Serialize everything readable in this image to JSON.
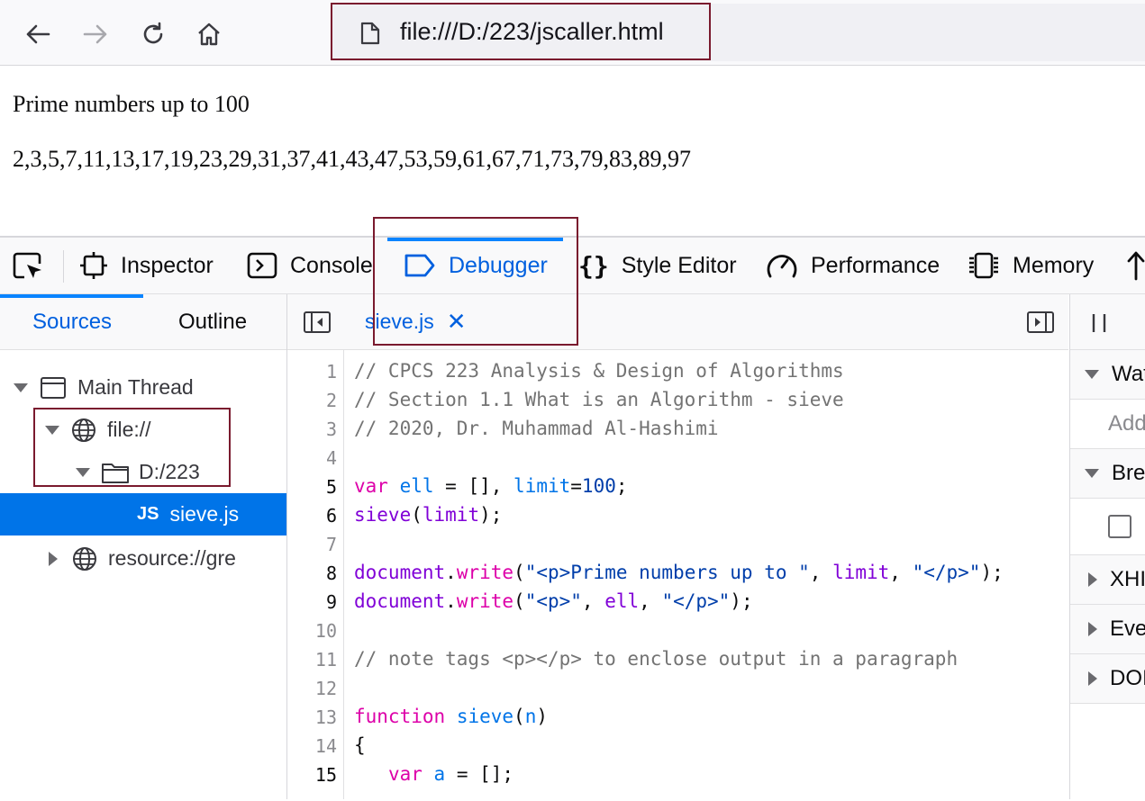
{
  "browser": {
    "url": "file:///D:/223/jscaller.html"
  },
  "page": {
    "heading": "Prime numbers up to 100",
    "primes": "2,3,5,7,11,13,17,19,23,29,31,37,41,43,47,53,59,61,67,71,73,79,83,89,97"
  },
  "devtools": {
    "tabs": [
      {
        "label": "Inspector"
      },
      {
        "label": "Console"
      },
      {
        "label": "Debugger"
      },
      {
        "label": "Style Editor"
      },
      {
        "label": "Performance"
      },
      {
        "label": "Memory"
      }
    ],
    "left_tabs": [
      {
        "label": "Sources"
      },
      {
        "label": "Outline"
      }
    ],
    "tree": [
      {
        "label": "Main Thread"
      },
      {
        "label": "file://"
      },
      {
        "label": "D:/223"
      },
      {
        "label": "sieve.js",
        "badge": "JS"
      },
      {
        "label": "resource://gre"
      }
    ],
    "editor_tab": "sieve.js",
    "right_panels": [
      {
        "label": "Wat"
      },
      {
        "label": "Add"
      },
      {
        "label": "Brea"
      },
      {
        "label": "XHI"
      },
      {
        "label": "Eve"
      },
      {
        "label": "DOI"
      }
    ],
    "line_numbers": [
      "1",
      "2",
      "3",
      "4",
      "5",
      "6",
      "7",
      "8",
      "9",
      "10",
      "11",
      "12",
      "13",
      "14",
      "15"
    ],
    "code": [
      "// CPCS 223 Analysis & Design of Algorithms",
      "// Section 1.1 What is an Algorithm - sieve",
      "// 2020, Dr. Muhammad Al-Hashimi",
      "",
      "var ell = [], limit=100;",
      "sieve(limit);",
      "",
      "document.write(\"<p>Prime numbers up to \", limit, \"</p>\");",
      "document.write(\"<p>\", ell, \"</p>\");",
      "",
      "// note tags <p></p> to enclose output in a paragraph",
      "",
      "function sieve(n)",
      "{",
      "   var a = [];"
    ]
  }
}
